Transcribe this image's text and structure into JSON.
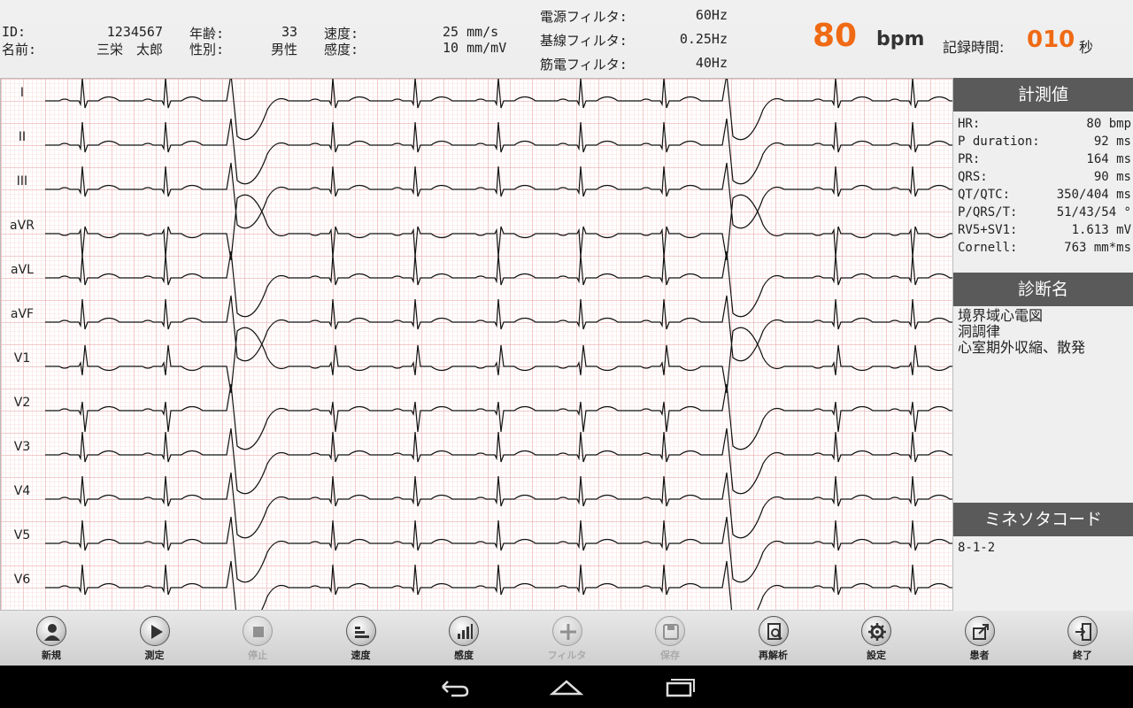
{
  "header": {
    "id_label": "ID:",
    "id_value": "1234567",
    "name_label": "名前:",
    "name_value": "三栄　太郎",
    "age_label": "年齢:",
    "age_value": "33",
    "sex_label": "性別:",
    "sex_value": "男性",
    "speed_label": "速度:",
    "speed_value": "25 mm/s",
    "sens_label": "感度:",
    "sens_value": "10 mm/mV",
    "power_filter_label": "電源フィルタ:",
    "power_filter_value": "60Hz",
    "baseline_filter_label": "基線フィルタ:",
    "baseline_filter_value": "0.25Hz",
    "muscle_filter_label": "筋電フィルタ:",
    "muscle_filter_value": "40Hz",
    "heart_rate": "80",
    "heart_rate_unit": "bpm",
    "rec_time_label": "記録時間:",
    "rec_time_value": "010",
    "rec_time_unit": "秒"
  },
  "leads": [
    "I",
    "II",
    "III",
    "aVR",
    "aVL",
    "aVF",
    "V1",
    "V2",
    "V3",
    "V4",
    "V5",
    "V6"
  ],
  "side": {
    "measurements_title": "計測値",
    "measurements": [
      {
        "k": "HR:",
        "v": "80 bmp"
      },
      {
        "k": "P duration:",
        "v": "92 ms"
      },
      {
        "k": "PR:",
        "v": "164 ms"
      },
      {
        "k": "QRS:",
        "v": "90 ms"
      },
      {
        "k": "QT/QTC:",
        "v": "350/404 ms"
      },
      {
        "k": "P/QRS/T:",
        "v": "51/43/54 °"
      },
      {
        "k": "RV5+SV1:",
        "v": "1.613 mV"
      },
      {
        "k": "Cornell:",
        "v": "763 mm*ms"
      }
    ],
    "diagnosis_title": "診断名",
    "diagnosis": [
      "境界域心電図",
      "洞調律",
      "心室期外収縮、散発"
    ],
    "minnesota_title": "ミネソタコード",
    "minnesota": "8-1-2"
  },
  "toolbar": [
    {
      "label": "新規",
      "icon": "person-icon",
      "enabled": true
    },
    {
      "label": "測定",
      "icon": "play-icon",
      "enabled": true
    },
    {
      "label": "停止",
      "icon": "stop-icon",
      "enabled": false
    },
    {
      "label": "速度",
      "icon": "speed-icon",
      "enabled": true
    },
    {
      "label": "感度",
      "icon": "bar-chart-icon",
      "enabled": true
    },
    {
      "label": "フィルタ",
      "icon": "filter-icon",
      "enabled": false
    },
    {
      "label": "保存",
      "icon": "save-icon",
      "enabled": false
    },
    {
      "label": "再解析",
      "icon": "reanalyze-icon",
      "enabled": true
    },
    {
      "label": "設定",
      "icon": "gear-icon",
      "enabled": true
    },
    {
      "label": "患者",
      "icon": "patient-icon",
      "enabled": true
    },
    {
      "label": "終了",
      "icon": "exit-icon",
      "enabled": true
    }
  ],
  "colors": {
    "accent": "#f06a14",
    "grid_minor": "#f6c6c6",
    "grid_major": "#e89a9a",
    "section_header": "#5a5a5a"
  }
}
